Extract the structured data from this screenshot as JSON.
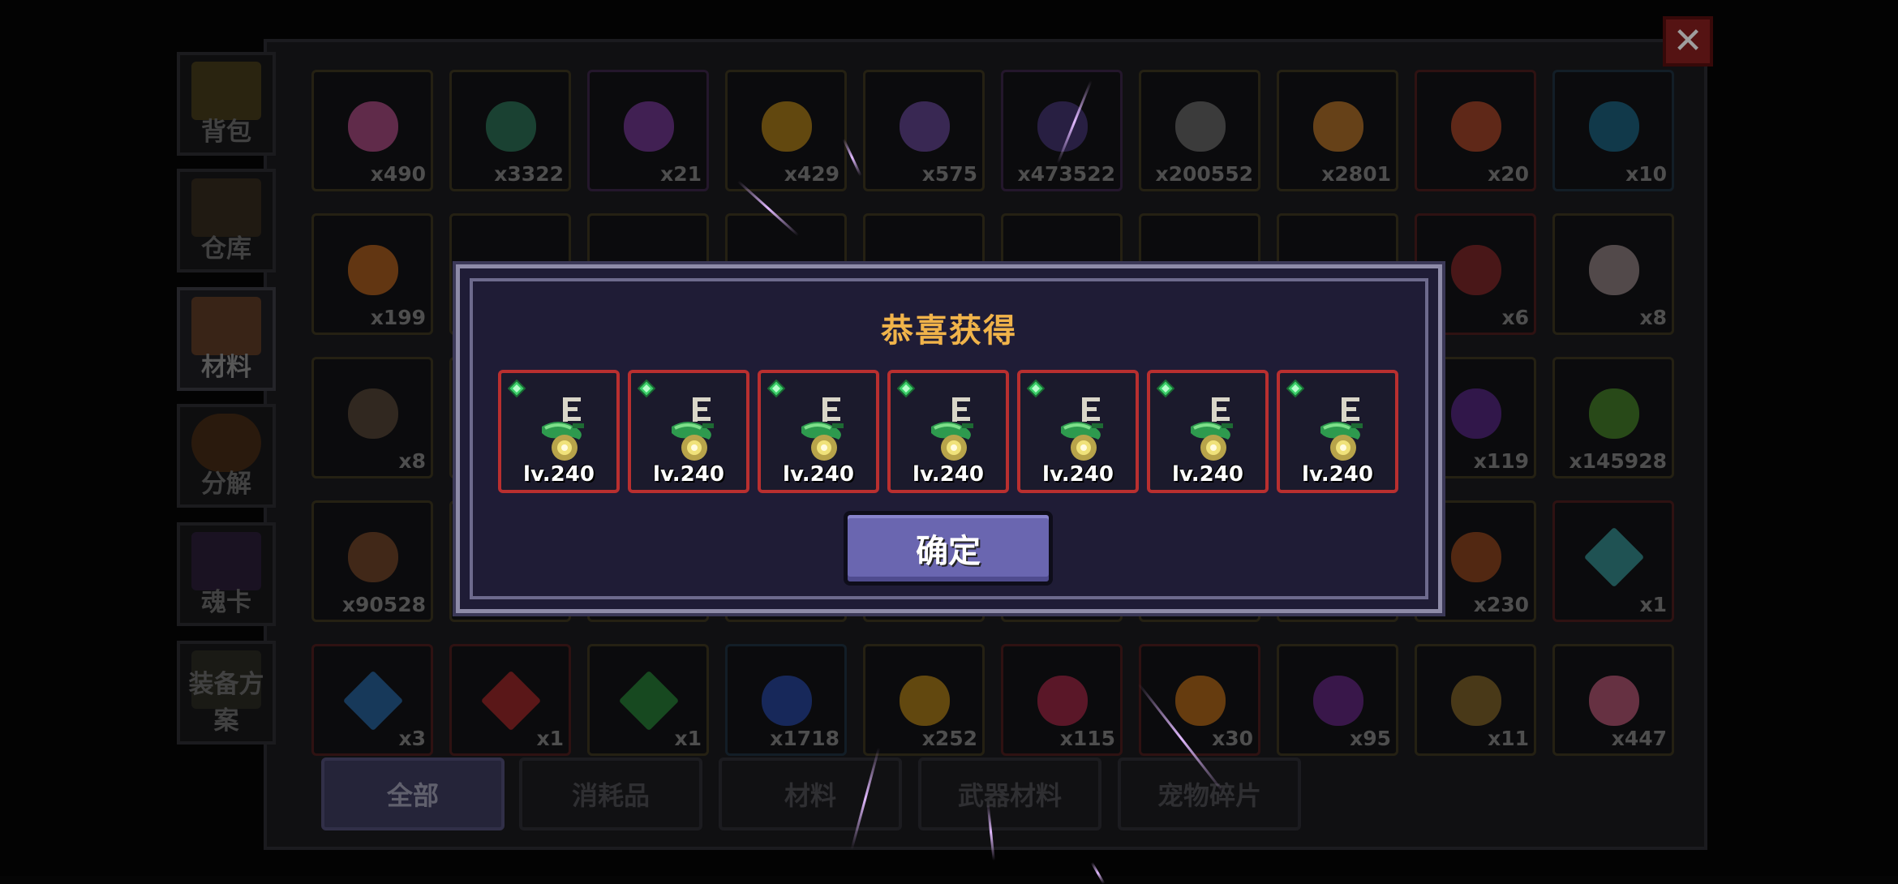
{
  "sidebar": {
    "items": [
      {
        "label": "背包"
      },
      {
        "label": "仓库"
      },
      {
        "label": "材料",
        "active": true
      },
      {
        "label": "分解"
      },
      {
        "label": "魂卡"
      },
      {
        "label": "装备方案"
      }
    ]
  },
  "grid": {
    "rows": [
      [
        {
          "icon": "pink-gem-icon",
          "qty": "x490"
        },
        {
          "icon": "green-coin-icon",
          "qty": "x3322"
        },
        {
          "icon": "purple-crystal-icon",
          "qty": "x21"
        },
        {
          "icon": "gold-coin-icon",
          "qty": "x429"
        },
        {
          "icon": "purple-flame-icon",
          "qty": "x575"
        },
        {
          "icon": "purple-scroll-icon",
          "qty": "x473522"
        },
        {
          "icon": "grey-ore-icon",
          "qty": "x200552"
        },
        {
          "icon": "orange-ore-icon",
          "qty": "x2801"
        },
        {
          "icon": "red-ore-icon",
          "qty": "x20"
        },
        {
          "icon": "blue-key-drop-icon",
          "qty": "x10"
        }
      ],
      [
        {
          "icon": "orange-key-drop-icon",
          "qty": "x199"
        },
        {
          "icon": "",
          "qty": ""
        },
        {
          "icon": "",
          "qty": ""
        },
        {
          "icon": "",
          "qty": ""
        },
        {
          "icon": "",
          "qty": ""
        },
        {
          "icon": "",
          "qty": ""
        },
        {
          "icon": "",
          "qty": ""
        },
        {
          "icon": "",
          "qty": ""
        },
        {
          "icon": "red-demon-mask-icon",
          "qty": "x6"
        },
        {
          "icon": "pale-creature-icon",
          "qty": "x8"
        }
      ],
      [
        {
          "icon": "witch-figure-icon",
          "qty": "x8"
        },
        {
          "icon": "",
          "qty": ""
        },
        {
          "icon": "",
          "qty": ""
        },
        {
          "icon": "",
          "qty": ""
        },
        {
          "icon": "",
          "qty": ""
        },
        {
          "icon": "",
          "qty": ""
        },
        {
          "icon": "",
          "qty": ""
        },
        {
          "icon": "",
          "qty": ""
        },
        {
          "icon": "purple-horned-icon",
          "qty": "x119"
        },
        {
          "icon": "green-slime-icon",
          "qty": "x145928"
        }
      ],
      [
        {
          "icon": "leather-hide-icon",
          "qty": "x90528"
        },
        {
          "icon": "",
          "qty": ""
        },
        {
          "icon": "",
          "qty": ""
        },
        {
          "icon": "",
          "qty": ""
        },
        {
          "icon": "",
          "qty": ""
        },
        {
          "icon": "",
          "qty": ""
        },
        {
          "icon": "",
          "qty": ""
        },
        {
          "icon": "",
          "qty": ""
        },
        {
          "icon": "orange-creature-icon",
          "qty": "x230"
        },
        {
          "icon": "rainbow-diamond-icon",
          "qty": "x1"
        }
      ],
      [
        {
          "icon": "blue-diamond-icon",
          "qty": "x3"
        },
        {
          "icon": "red-diamond-icon",
          "qty": "x1"
        },
        {
          "icon": "green-diamond-icon",
          "qty": "x1"
        },
        {
          "icon": "blue-shard-icon",
          "qty": "x1718"
        },
        {
          "icon": "gold-star-shard-icon",
          "qty": "x252"
        },
        {
          "icon": "red-crystal-cluster-icon",
          "qty": "x115"
        },
        {
          "icon": "flame-burst-icon",
          "qty": "x30"
        },
        {
          "icon": "purple-pod-icon",
          "qty": "x95"
        },
        {
          "icon": "medal-icon",
          "qty": "x11"
        },
        {
          "icon": "pink-feather-icon",
          "qty": "x447"
        }
      ]
    ]
  },
  "bottom_tabs": [
    {
      "label": "全部",
      "active": true
    },
    {
      "label": "消耗品"
    },
    {
      "label": "材料"
    },
    {
      "label": "武器材料"
    },
    {
      "label": "宠物碎片"
    }
  ],
  "dialog": {
    "title": "恭喜获得",
    "rewards": [
      {
        "level": "lv.240",
        "icon": "serpent-staff-icon"
      },
      {
        "level": "lv.240",
        "icon": "serpent-staff-icon"
      },
      {
        "level": "lv.240",
        "icon": "serpent-staff-icon"
      },
      {
        "level": "lv.240",
        "icon": "serpent-staff-icon"
      },
      {
        "level": "lv.240",
        "icon": "serpent-staff-icon"
      },
      {
        "level": "lv.240",
        "icon": "serpent-staff-icon"
      },
      {
        "level": "lv.240",
        "icon": "serpent-staff-icon"
      }
    ],
    "confirm_label": "确定"
  },
  "colors": {
    "dialog_bg": "#1f1c36",
    "title": "#f0b34a",
    "reward_border": "#b92f2f",
    "confirm_button": "#6a66b0"
  }
}
